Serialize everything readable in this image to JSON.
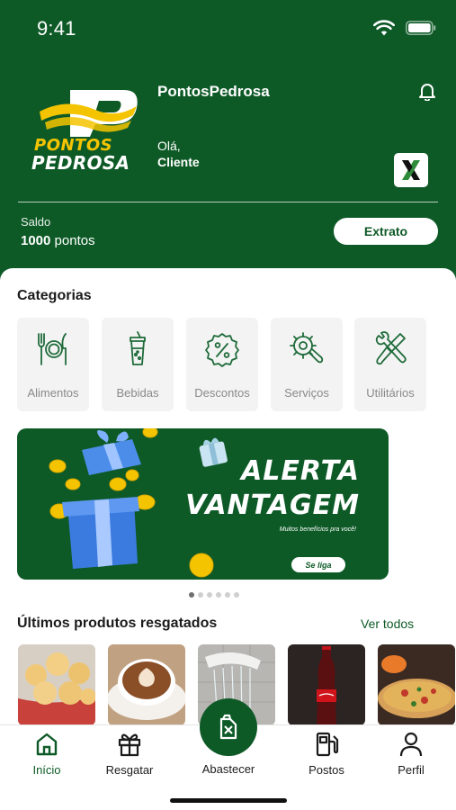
{
  "status_bar": {
    "time": "9:41"
  },
  "header": {
    "logo_line_1": "PONTOS",
    "logo_line_2": "PEDROSA",
    "brand_name": "PontosPedrosa",
    "greeting": "Olá,",
    "user_name": "Cliente",
    "balance_label": "Saldo",
    "balance_amount": "1000",
    "balance_unit": " pontos",
    "extract_label": "Extrato"
  },
  "categories": {
    "title": "Categorias",
    "items": [
      {
        "label": "Alimentos",
        "icon": "utensils-icon"
      },
      {
        "label": "Bebidas",
        "icon": "drink-cup-icon"
      },
      {
        "label": "Descontos",
        "icon": "discount-badge-icon"
      },
      {
        "label": "Serviços",
        "icon": "gear-wrench-icon"
      },
      {
        "label": "Utilitários",
        "icon": "tools-icon"
      }
    ]
  },
  "banner": {
    "title_line_1": "ALERTA",
    "title_line_2": "VANTAGEM",
    "subtitle": "Muitos benefícios pra você!",
    "cta": "Se liga"
  },
  "carousel": {
    "count": 6,
    "active": 0
  },
  "products": {
    "title": "Últimos produtos resgatados",
    "see_all": "Ver todos",
    "items": [
      "cheese-bread",
      "coffee",
      "shower",
      "coca-cola",
      "pizza"
    ]
  },
  "bottom_nav": {
    "items": [
      {
        "label": "Início",
        "icon": "home-icon",
        "active": true
      },
      {
        "label": "Resgatar",
        "icon": "gift-icon",
        "active": false
      },
      {
        "label": "Abastecer",
        "icon": "fuel-can-icon",
        "active": false
      },
      {
        "label": "Postos",
        "icon": "gas-pump-icon",
        "active": false
      },
      {
        "label": "Perfil",
        "icon": "user-icon",
        "active": false
      }
    ]
  },
  "colors": {
    "brand_green": "#0e5a27",
    "brand_yellow": "#f5c400",
    "category_bg": "#f3f3f3"
  }
}
